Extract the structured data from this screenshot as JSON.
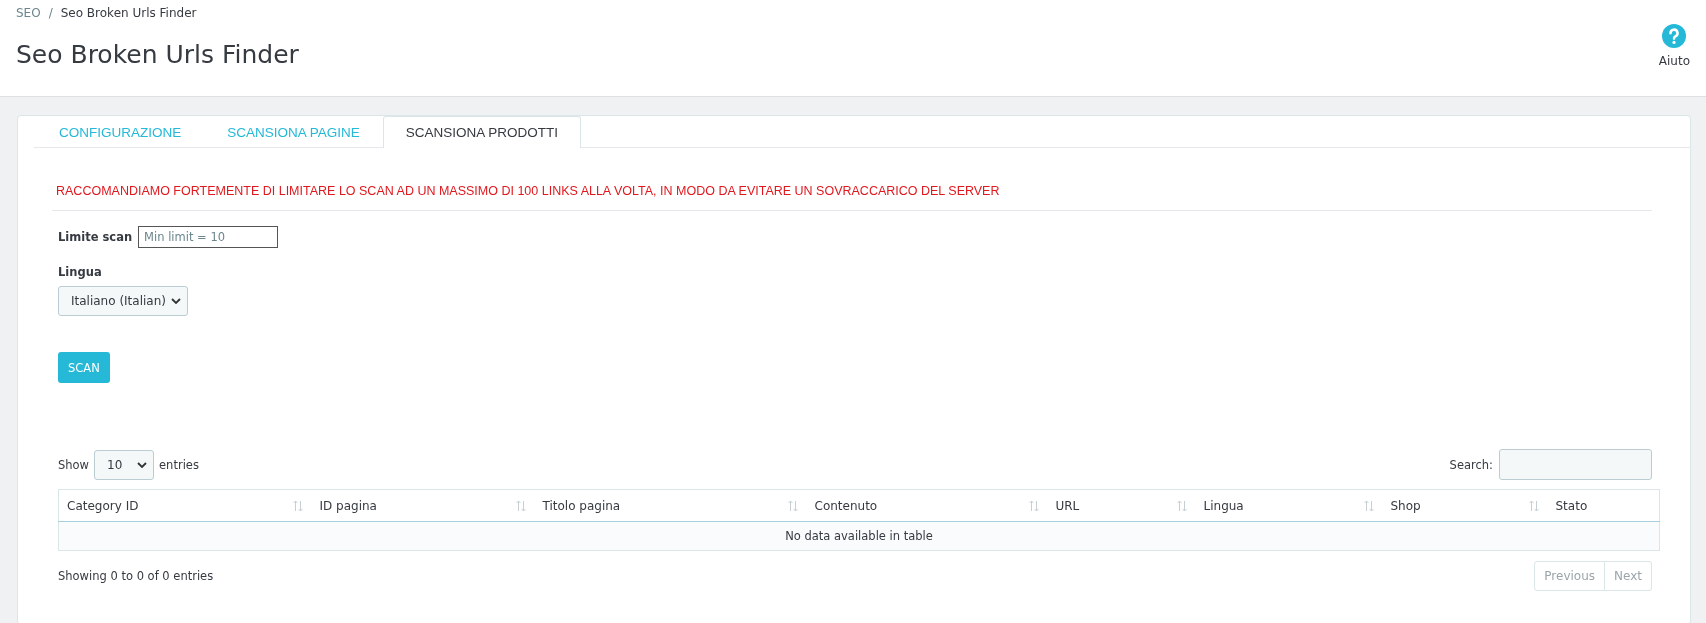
{
  "breadcrumb": [
    "SEO",
    "Seo Broken Urls Finder"
  ],
  "breadcrumb_separator": "/",
  "page_title": "Seo Broken Urls Finder",
  "help": {
    "label": "Aiuto"
  },
  "tabs": [
    {
      "label": "CONFIGURAZIONE",
      "selected": false
    },
    {
      "label": "SCANSIONA PAGINE",
      "selected": false
    },
    {
      "label": "SCANSIONA PRODOTTI",
      "selected": true
    }
  ],
  "warning": "RACCOMANDIAMO FORTEMENTE DI LIMITARE LO SCAN AD UN MASSIMO DI 100 LINKS ALLA VOLTA, IN MODO DA EVITARE UN SOVRACCARICO DEL SERVER",
  "limit_field": {
    "label": "Limite scan",
    "placeholder": "Min limit = 10"
  },
  "language_field": {
    "label": "Lingua",
    "value": "Italiano (Italian)"
  },
  "scan_button": "SCAN",
  "table": {
    "length": {
      "prefix": "Show",
      "value": "10",
      "suffix": "entries"
    },
    "search_label": "Search:",
    "columns": [
      "Category ID",
      "ID pagina",
      "Titolo pagina",
      "Contenuto",
      "URL",
      "Lingua",
      "Shop",
      "Stato"
    ],
    "empty_message": "No data available in table",
    "info": "Showing 0 to 0 of 0 entries",
    "pagination": [
      {
        "label": "Previous",
        "disabled": true
      },
      {
        "label": "Next",
        "disabled": true
      }
    ]
  }
}
